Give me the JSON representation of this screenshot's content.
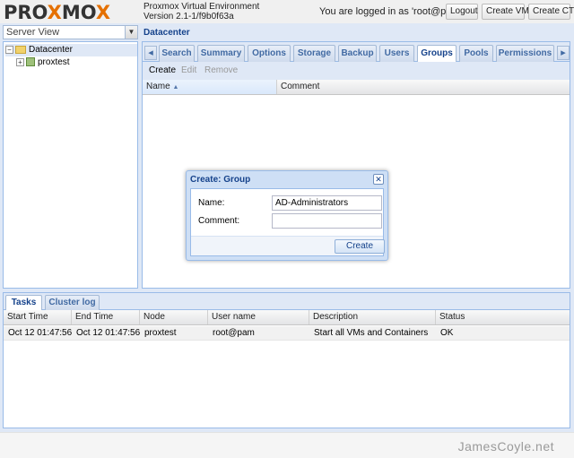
{
  "header": {
    "logo_left": "PRO",
    "logo_x": "X",
    "logo_mid": "MO",
    "logo_x2": "X",
    "product": "Proxmox Virtual Environment",
    "version": "Version 2.1-1/f9b0f63a",
    "logged_in": "You are logged in as 'root@pam'",
    "logout": "Logout",
    "create_vm": "Create VM",
    "create_ct": "Create CT"
  },
  "sidebar": {
    "view_select": "Server View",
    "tree": [
      {
        "label": "Datacenter"
      },
      {
        "label": "proxtest"
      }
    ]
  },
  "main": {
    "title": "Datacenter",
    "tabs": [
      "Search",
      "Summary",
      "Options",
      "Storage",
      "Backup",
      "Users",
      "Groups",
      "Pools",
      "Permissions"
    ],
    "active_tab": "Groups",
    "toolbar": {
      "create": "Create",
      "edit": "Edit",
      "remove": "Remove"
    },
    "columns": [
      "Name",
      "Comment"
    ]
  },
  "dialog": {
    "title": "Create: Group",
    "name_label": "Name:",
    "name_value": "AD-Administrators",
    "comment_label": "Comment:",
    "comment_value": "",
    "submit": "Create"
  },
  "tasks": {
    "tabs": [
      "Tasks",
      "Cluster log"
    ],
    "active_tab": "Tasks",
    "columns": [
      "Start Time",
      "End Time",
      "Node",
      "User name",
      "Description",
      "Status"
    ],
    "rows": [
      [
        "Oct 12 01:47:56",
        "Oct 12 01:47:56",
        "proxtest",
        "root@pam",
        "Start all VMs and Containers",
        "OK"
      ]
    ]
  },
  "watermark": "JamesCoyle.net",
  "colors": {
    "background": "#dfe8f6",
    "border": "#99bbe8",
    "title_text": "#15428b",
    "logo_accent": "#e57000"
  }
}
